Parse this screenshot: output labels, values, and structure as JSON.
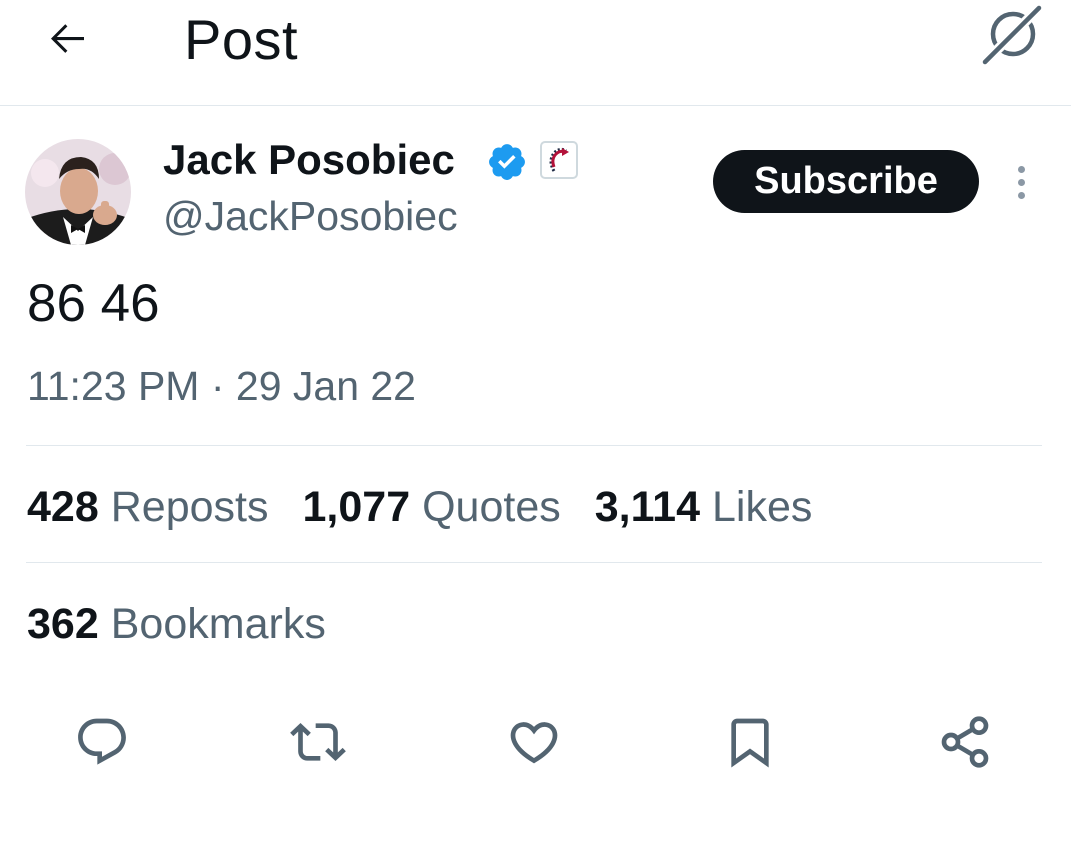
{
  "header": {
    "title": "Post",
    "back_icon": "arrow-left-icon",
    "grok_icon": "grok-icon"
  },
  "author": {
    "name": "Jack Posobiec",
    "handle": "@JackPosobiec",
    "verified": true,
    "verified_color": "#1d9bf0",
    "affiliate_icon": "affiliate-badge-icon"
  },
  "subscribe_label": "Subscribe",
  "post": {
    "text": "86 46",
    "time": "11:23 PM",
    "separator": " · ",
    "date": "29 Jan 22"
  },
  "stats": {
    "reposts": {
      "count": "428",
      "label": "Reposts"
    },
    "quotes": {
      "count": "1,077",
      "label": "Quotes"
    },
    "likes": {
      "count": "3,114",
      "label": "Likes"
    },
    "bookmarks": {
      "count": "362",
      "label": "Bookmarks"
    }
  },
  "actions": [
    {
      "name": "reply",
      "icon": "reply-icon"
    },
    {
      "name": "repost",
      "icon": "repost-icon"
    },
    {
      "name": "like",
      "icon": "heart-icon"
    },
    {
      "name": "bookmark",
      "icon": "bookmark-icon"
    },
    {
      "name": "share",
      "icon": "share-icon"
    }
  ],
  "colors": {
    "text_primary": "#0f1419",
    "text_secondary": "#536471",
    "icon": "#536471",
    "divider": "#e1e8ed",
    "subscribe_bg": "#0f1419"
  }
}
